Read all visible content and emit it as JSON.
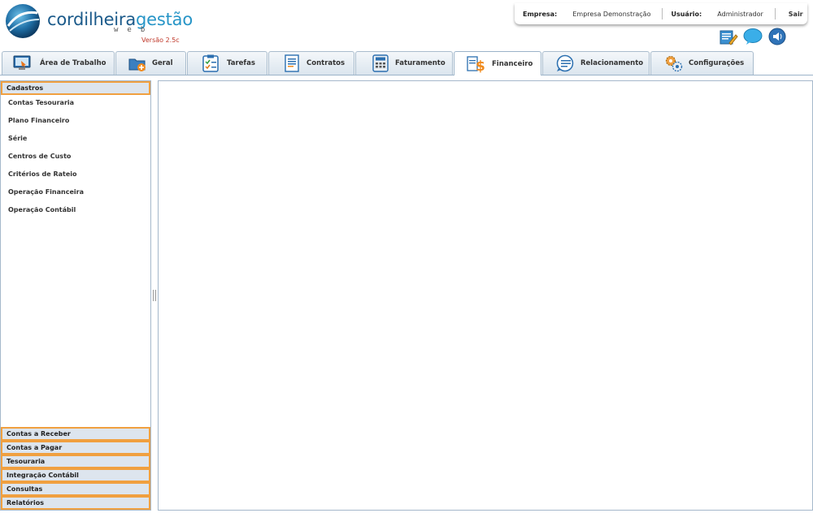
{
  "brand": {
    "name_part1": "cordilheira",
    "name_part2": "gestão",
    "subtitle": "web",
    "version": "Versão 2.5c"
  },
  "session": {
    "company_label": "Empresa:",
    "company_value": "Empresa Demonstração",
    "user_label": "Usuário:",
    "user_value": "Administrador",
    "logout_label": "Sair"
  },
  "quick_icons": [
    "notepad-icon",
    "chat-icon",
    "sound-icon"
  ],
  "tabs": [
    {
      "label": "Área de Trabalho",
      "icon": "monitor-icon"
    },
    {
      "label": "Geral",
      "icon": "folder-add-icon"
    },
    {
      "label": "Tarefas",
      "icon": "checklist-icon"
    },
    {
      "label": "Contratos",
      "icon": "document-icon"
    },
    {
      "label": "Faturamento",
      "icon": "calculator-icon"
    },
    {
      "label": "Financeiro",
      "icon": "money-icon",
      "active": true
    },
    {
      "label": "Relacionamento",
      "icon": "contact-icon"
    },
    {
      "label": "Configurações",
      "icon": "gears-icon"
    }
  ],
  "sidebar": {
    "open_section": {
      "title": "Cadastros",
      "items": [
        "Contas Tesouraria",
        "Plano Financeiro",
        "Série",
        "Centros de Custo",
        "Critérios de Rateio",
        "Operação Financeira",
        "Operação Contábil"
      ]
    },
    "collapsed_sections": [
      "Contas a Receber",
      "Contas a Pagar",
      "Tesouraria",
      "Integração Contábil",
      "Consultas",
      "Relatórios"
    ]
  },
  "colors": {
    "accent_orange": "#f0a040",
    "brand_dark": "#1b5a8a",
    "brand_light": "#2795c7",
    "version_red": "#c0392b"
  }
}
